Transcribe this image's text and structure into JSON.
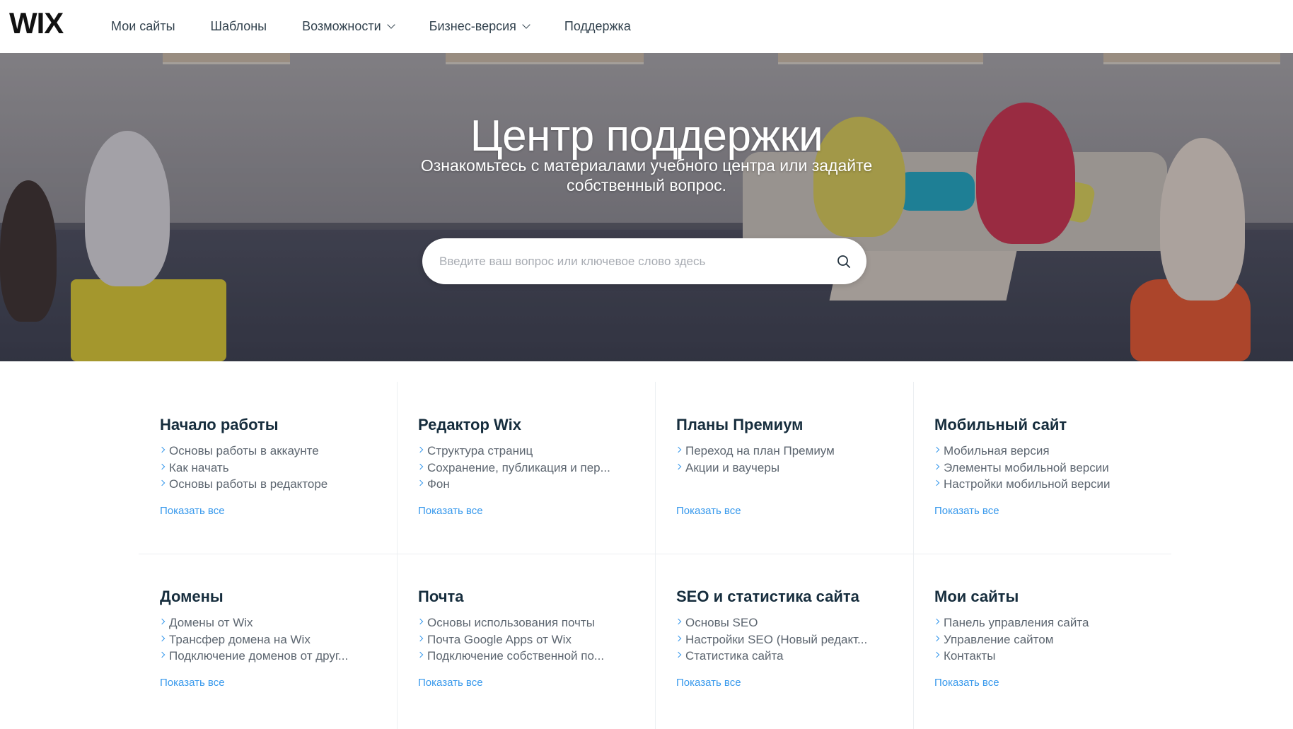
{
  "header": {
    "logo": "WIX",
    "nav": [
      {
        "label": "Мои сайты",
        "dropdown": false
      },
      {
        "label": "Шаблоны",
        "dropdown": false
      },
      {
        "label": "Возможности",
        "dropdown": true
      },
      {
        "label": "Бизнес-версия",
        "dropdown": true
      },
      {
        "label": "Поддержка",
        "dropdown": false
      }
    ]
  },
  "hero": {
    "title": "Центр поддержки",
    "subtitle": "Ознакомьтесь с материалами учебного центра или задайте собственный вопрос.",
    "search": {
      "value": "",
      "placeholder": "Введите ваш вопрос или ключевое слово здесь",
      "icon": "search-icon"
    }
  },
  "categories": [
    {
      "title": "Начало работы",
      "items": [
        "Основы работы в аккаунте",
        "Как начать",
        "Основы работы в редакторе"
      ],
      "show_all": "Показать все"
    },
    {
      "title": "Редактор Wix",
      "items": [
        "Структура страниц",
        "Сохранение, публикация и пер...",
        "Фон"
      ],
      "show_all": "Показать все"
    },
    {
      "title": "Планы Премиум",
      "items": [
        "Переход на план Премиум",
        "Акции и ваучеры"
      ],
      "show_all": "Показать все"
    },
    {
      "title": "Мобильный сайт",
      "items": [
        "Мобильная версия",
        "Элементы мобильной версии",
        "Настройки мобильной версии"
      ],
      "show_all": "Показать все"
    },
    {
      "title": "Домены",
      "items": [
        "Домены от Wix",
        "Трансфер домена на Wix",
        "Подключение доменов от друг..."
      ],
      "show_all": "Показать все"
    },
    {
      "title": "Почта",
      "items": [
        "Основы использования почты",
        "Почта Google Apps от Wix",
        "Подключение собственной по..."
      ],
      "show_all": "Показать все"
    },
    {
      "title": "SEO и статистика сайта",
      "items": [
        "Основы SEO",
        "Настройки SEO (Новый редакт...",
        "Статистика сайта"
      ],
      "show_all": "Показать все"
    },
    {
      "title": "Мои сайты",
      "items": [
        "Панель управления сайта",
        "Управление сайтом",
        "Контакты"
      ],
      "show_all": "Показать все"
    }
  ],
  "colors": {
    "accent": "#3899ec",
    "text": "#162d3d",
    "muted": "#5d6670"
  }
}
